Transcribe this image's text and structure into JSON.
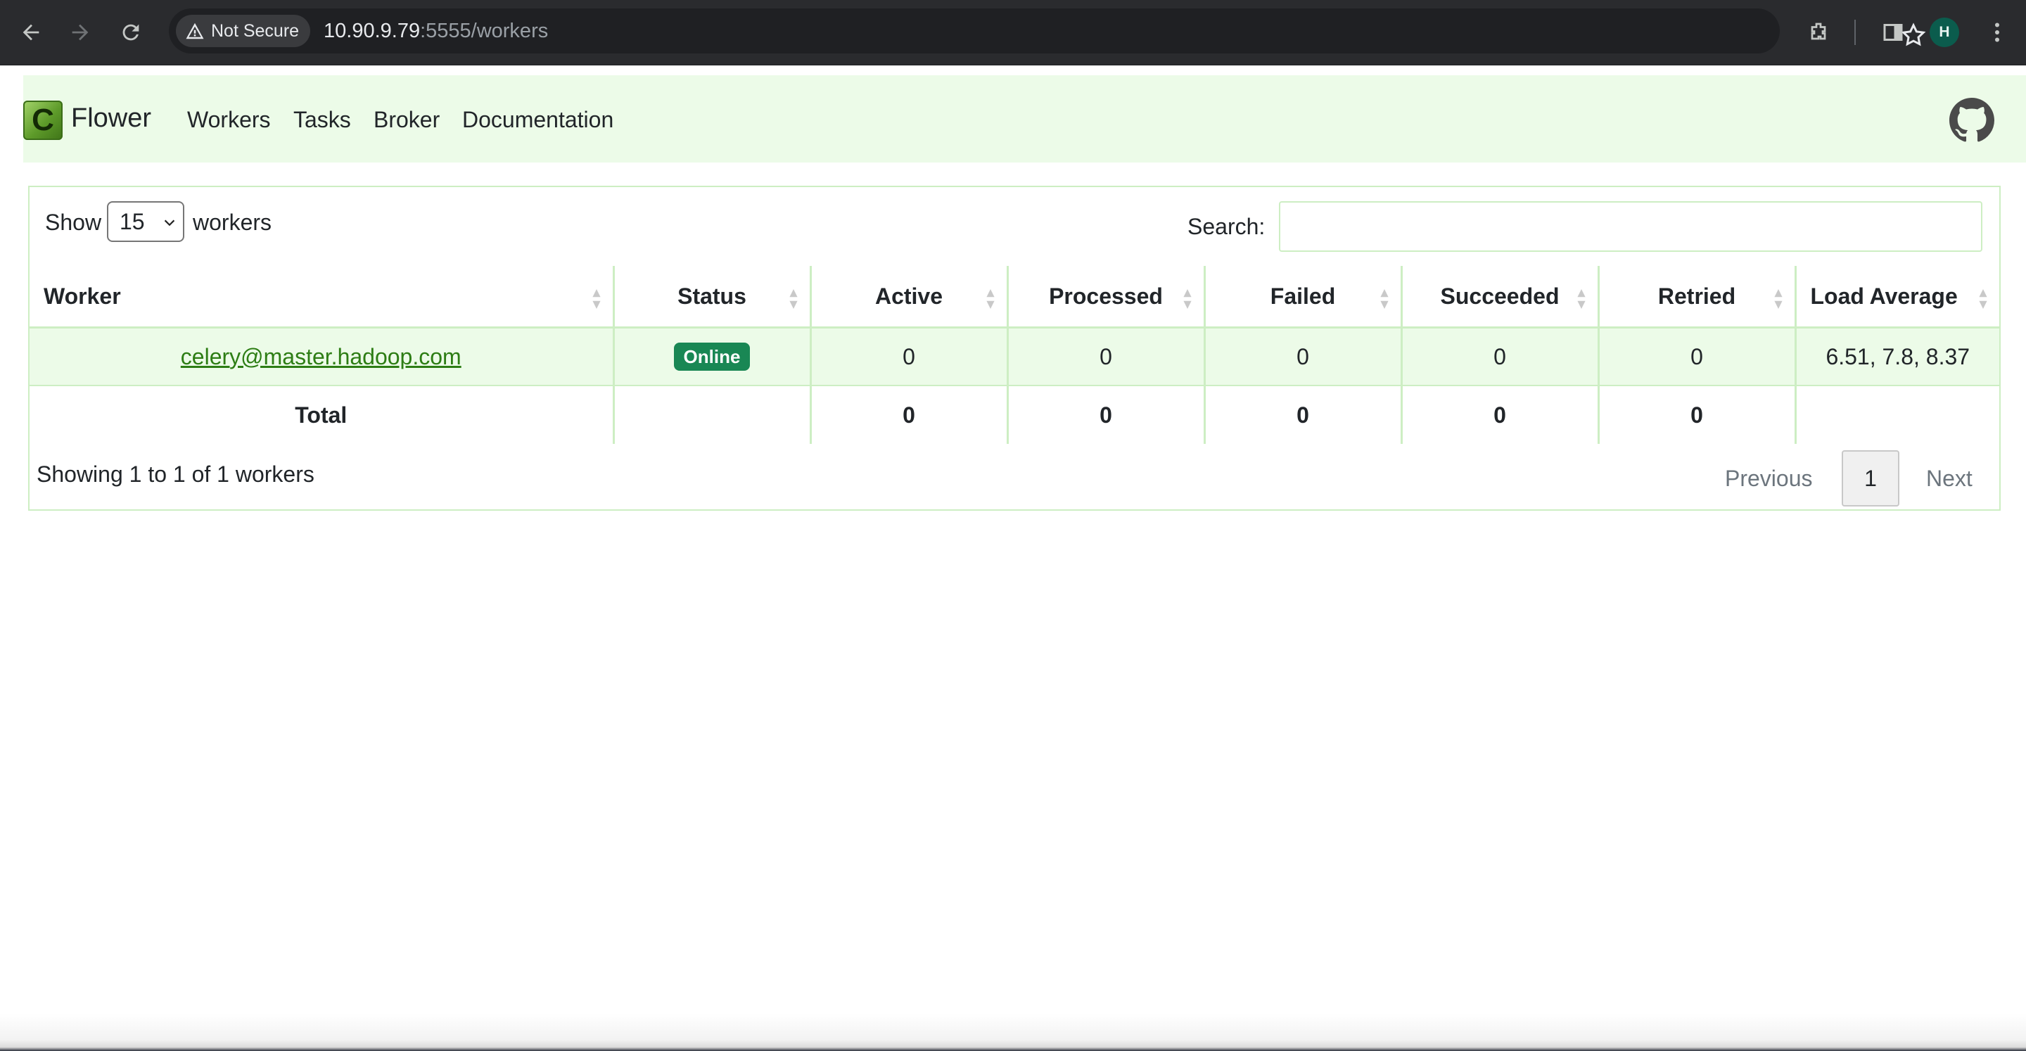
{
  "browser": {
    "security_label": "Not Secure",
    "url_host": "10.90.9.79",
    "url_rest": ":5555/workers",
    "profile_initial": "H"
  },
  "navbar": {
    "brand": "Flower",
    "links": [
      "Workers",
      "Tasks",
      "Broker",
      "Documentation"
    ]
  },
  "controls": {
    "show_label": "Show",
    "page_length": "15",
    "workers_label": "workers",
    "search_label": "Search:",
    "search_value": ""
  },
  "table": {
    "columns": [
      "Worker",
      "Status",
      "Active",
      "Processed",
      "Failed",
      "Succeeded",
      "Retried",
      "Load Average"
    ],
    "rows": [
      {
        "worker": "celery@master.hadoop.com",
        "status": "Online",
        "active": "0",
        "processed": "0",
        "failed": "0",
        "succeeded": "0",
        "retried": "0",
        "load_average": "6.51, 7.8, 8.37"
      }
    ],
    "total": {
      "label": "Total",
      "active": "0",
      "processed": "0",
      "failed": "0",
      "succeeded": "0",
      "retried": "0"
    }
  },
  "footer": {
    "info": "Showing 1 to 1 of 1 workers",
    "previous": "Previous",
    "current_page": "1",
    "next": "Next"
  },
  "colors": {
    "navbar_bg": "#ecfbe8",
    "border_green": "#cdeec3",
    "status_online": "#198754",
    "link_green": "#2d7d14"
  }
}
